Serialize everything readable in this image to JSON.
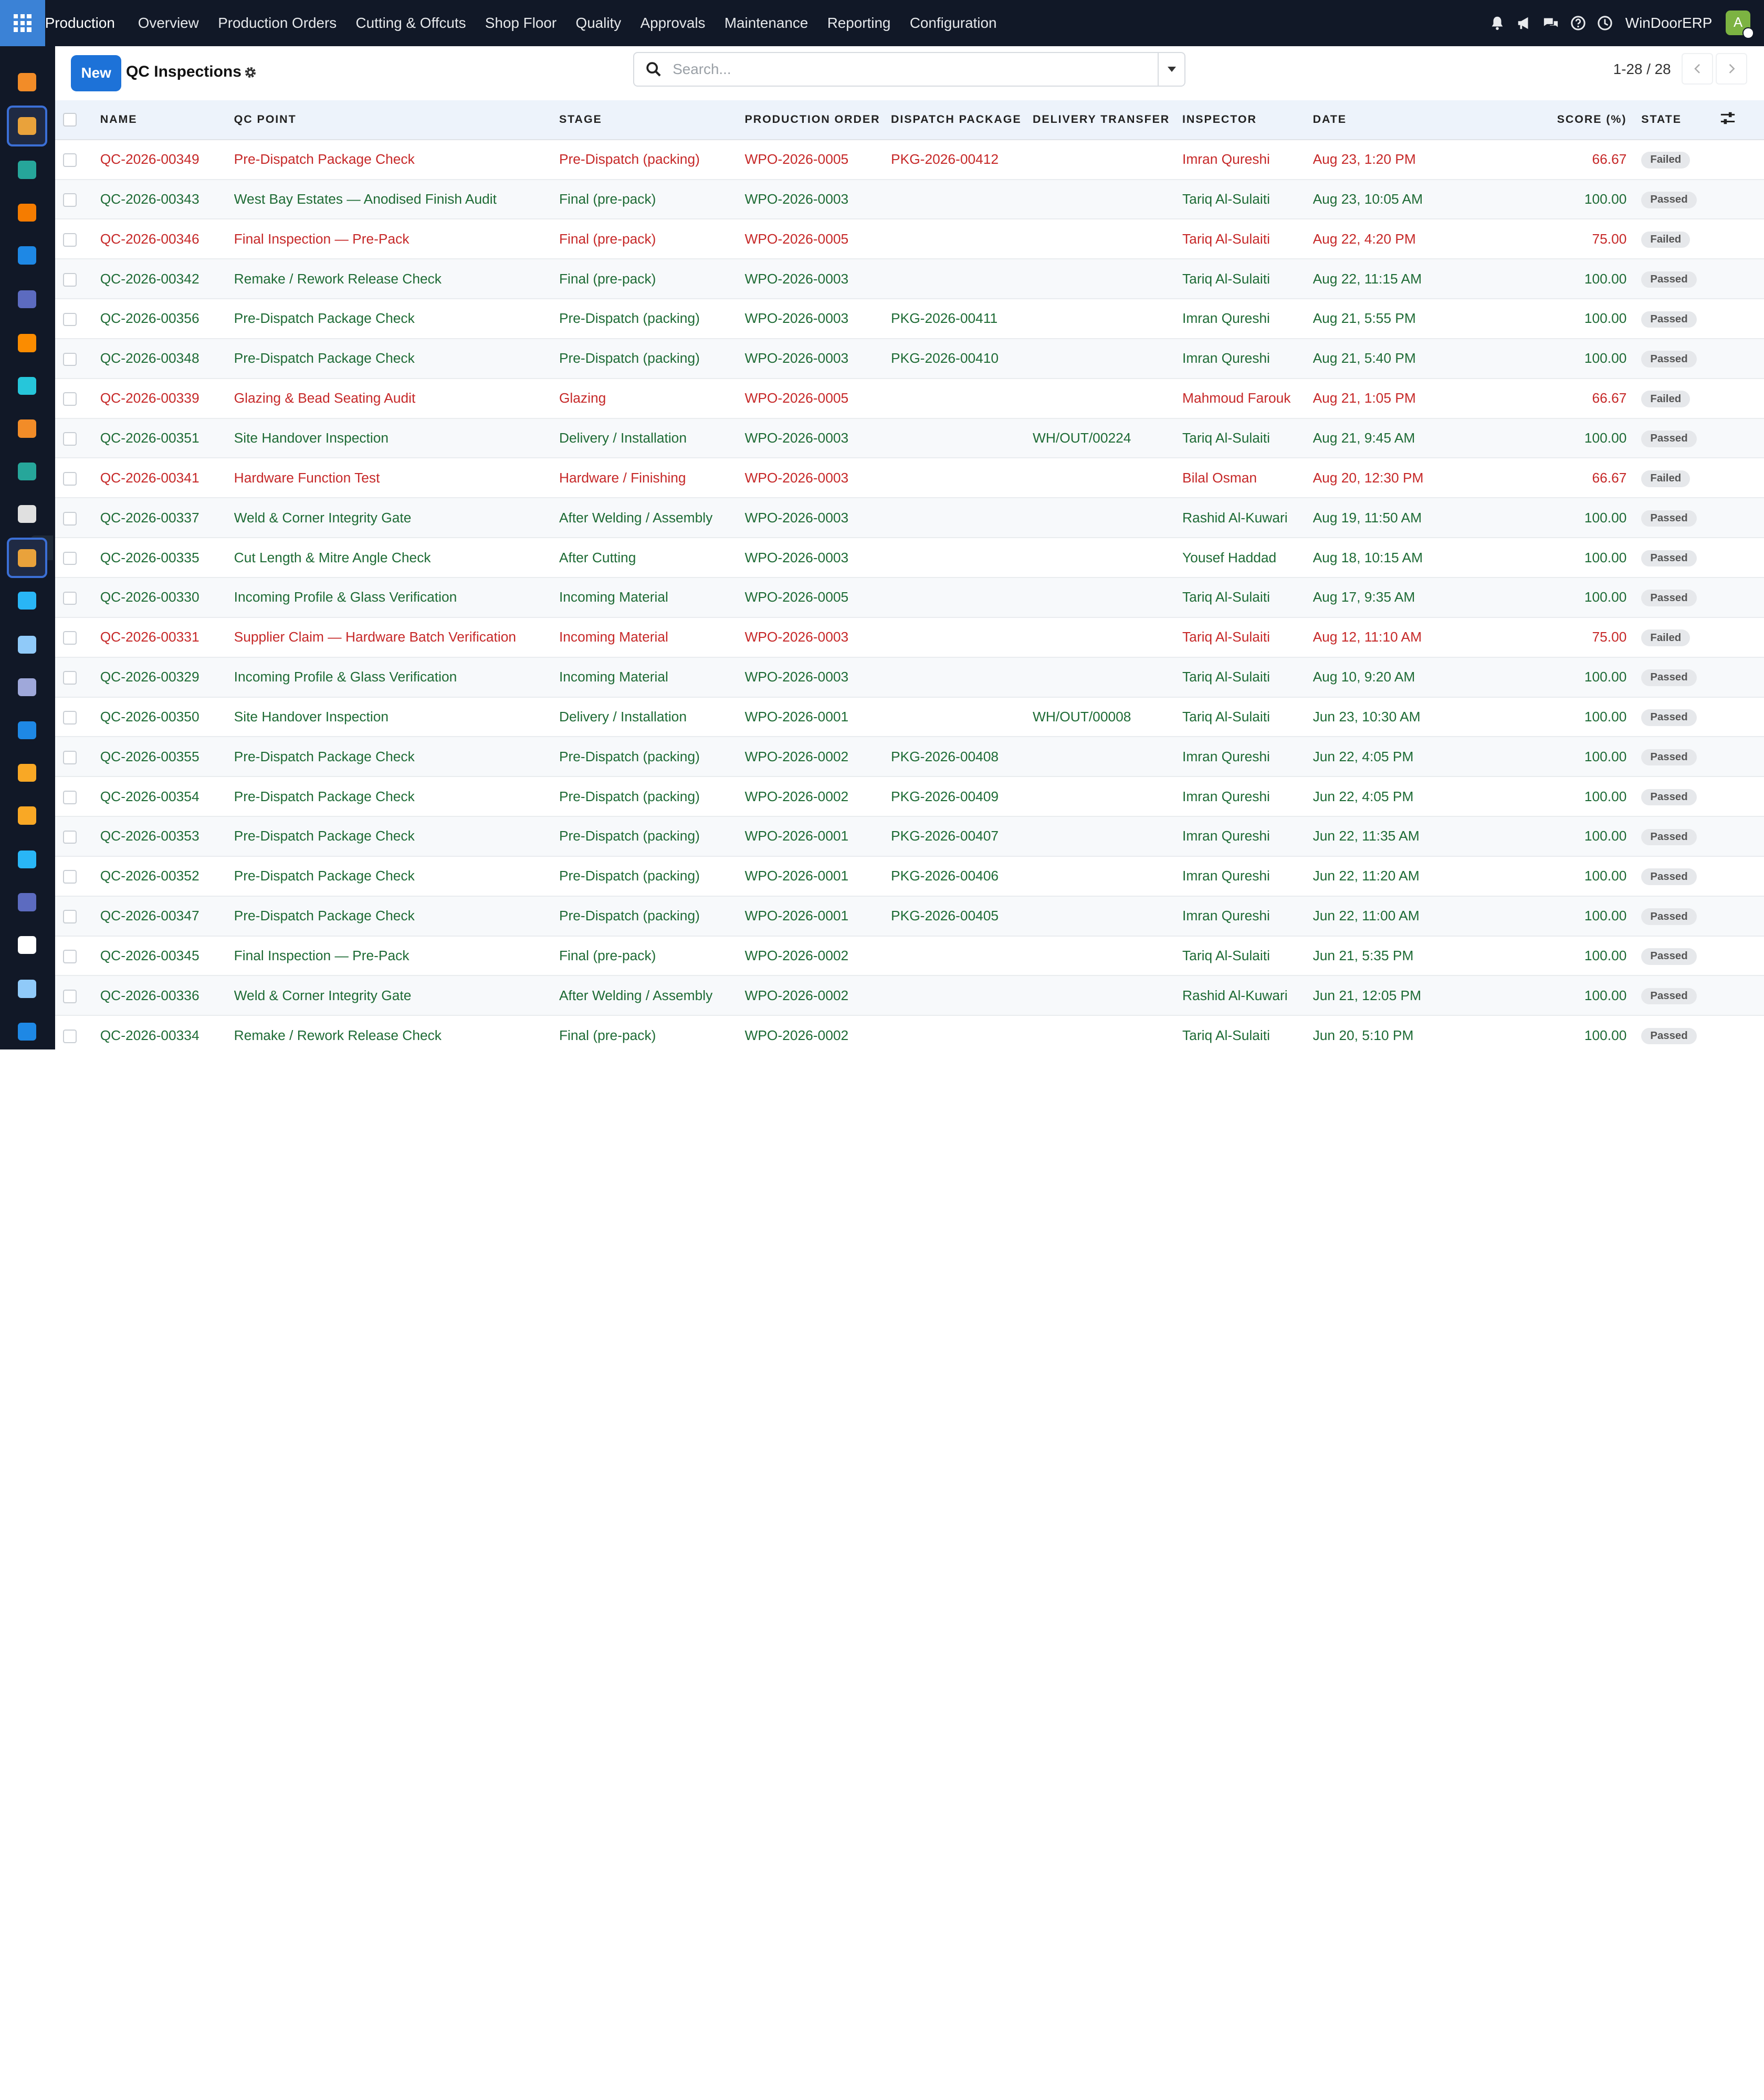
{
  "navbar": {
    "brand": "Production",
    "menu": [
      "Overview",
      "Production Orders",
      "Cutting & Offcuts",
      "Shop Floor",
      "Quality",
      "Approvals",
      "Maintenance",
      "Reporting",
      "Configuration"
    ],
    "company": "WinDoorERP",
    "avatar_letter": "A",
    "icons": [
      "bell-icon",
      "megaphone-icon",
      "chat-icon",
      "help-icon",
      "clock-icon"
    ]
  },
  "sidebar": {
    "icons": [
      {
        "name": "sales-app-icon",
        "color": "#f28c28"
      },
      {
        "name": "quality-app-icon",
        "color": "#e9a23b",
        "active": true
      },
      {
        "name": "contacts-app-icon",
        "color": "#26a69a"
      },
      {
        "name": "discuss-app-icon",
        "color": "#f57c00"
      },
      {
        "name": "website-app-icon",
        "color": "#1e88e5"
      },
      {
        "name": "mail-app-icon",
        "color": "#5c6bc0"
      },
      {
        "name": "chat-app-icon",
        "color": "#fb8c00"
      },
      {
        "name": "project-app-icon",
        "color": "#26c6da"
      },
      {
        "name": "reports-app-icon",
        "color": "#f28c28"
      },
      {
        "name": "employees-app-icon",
        "color": "#26a69a"
      },
      {
        "name": "inventory-app-icon",
        "color": "#e0e0e0"
      },
      {
        "name": "manufacturing-app-icon",
        "color": "#e9a23b",
        "active": true
      },
      {
        "name": "tasks-app-icon",
        "color": "#29b6f6"
      },
      {
        "name": "helpdesk-app-icon",
        "color": "#90caf9"
      },
      {
        "name": "packages-app-icon",
        "color": "#9fa8da"
      },
      {
        "name": "invoicing-app-icon",
        "color": "#1e88e5"
      },
      {
        "name": "team-app-icon",
        "color": "#f9a825"
      },
      {
        "name": "calendar-app-icon",
        "color": "#f9a825"
      },
      {
        "name": "sign-app-icon",
        "color": "#29b6f6"
      },
      {
        "name": "dashboard-app-icon",
        "color": "#5c6bc0"
      },
      {
        "name": "whatsapp-app-icon",
        "color": "#ffffff"
      },
      {
        "name": "planning-app-icon",
        "color": "#90caf9"
      },
      {
        "name": "website2-app-icon",
        "color": "#1e88e5"
      }
    ]
  },
  "control": {
    "new_label": "New",
    "title": "QC Inspections",
    "search_placeholder": "Search...",
    "pager": "1-28 / 28"
  },
  "table": {
    "columns": [
      "NAME",
      "QC POINT",
      "STAGE",
      "PRODUCTION ORDER",
      "DISPATCH PACKAGE",
      "DELIVERY TRANSFER",
      "INSPECTOR",
      "DATE",
      "SCORE (%)",
      "STATE"
    ],
    "rows": [
      {
        "name": "QC-2026-00349",
        "qc_point": "Pre-Dispatch Package Check",
        "stage": "Pre-Dispatch (packing)",
        "order": "WPO-2026-0005",
        "package": "PKG-2026-00412",
        "transfer": "",
        "inspector": "Imran Qureshi",
        "date": "Aug 23, 1:20 PM",
        "score": "66.67",
        "state": "Failed"
      },
      {
        "name": "QC-2026-00343",
        "qc_point": "West Bay Estates — Anodised Finish Audit",
        "stage": "Final (pre-pack)",
        "order": "WPO-2026-0003",
        "package": "",
        "transfer": "",
        "inspector": "Tariq Al-Sulaiti",
        "date": "Aug 23, 10:05 AM",
        "score": "100.00",
        "state": "Passed"
      },
      {
        "name": "QC-2026-00346",
        "qc_point": "Final Inspection — Pre-Pack",
        "stage": "Final (pre-pack)",
        "order": "WPO-2026-0005",
        "package": "",
        "transfer": "",
        "inspector": "Tariq Al-Sulaiti",
        "date": "Aug 22, 4:20 PM",
        "score": "75.00",
        "state": "Failed"
      },
      {
        "name": "QC-2026-00342",
        "qc_point": "Remake / Rework Release Check",
        "stage": "Final (pre-pack)",
        "order": "WPO-2026-0003",
        "package": "",
        "transfer": "",
        "inspector": "Tariq Al-Sulaiti",
        "date": "Aug 22, 11:15 AM",
        "score": "100.00",
        "state": "Passed"
      },
      {
        "name": "QC-2026-00356",
        "qc_point": "Pre-Dispatch Package Check",
        "stage": "Pre-Dispatch (packing)",
        "order": "WPO-2026-0003",
        "package": "PKG-2026-00411",
        "transfer": "",
        "inspector": "Imran Qureshi",
        "date": "Aug 21, 5:55 PM",
        "score": "100.00",
        "state": "Passed"
      },
      {
        "name": "QC-2026-00348",
        "qc_point": "Pre-Dispatch Package Check",
        "stage": "Pre-Dispatch (packing)",
        "order": "WPO-2026-0003",
        "package": "PKG-2026-00410",
        "transfer": "",
        "inspector": "Imran Qureshi",
        "date": "Aug 21, 5:40 PM",
        "score": "100.00",
        "state": "Passed"
      },
      {
        "name": "QC-2026-00339",
        "qc_point": "Glazing & Bead Seating Audit",
        "stage": "Glazing",
        "order": "WPO-2026-0005",
        "package": "",
        "transfer": "",
        "inspector": "Mahmoud Farouk",
        "date": "Aug 21, 1:05 PM",
        "score": "66.67",
        "state": "Failed"
      },
      {
        "name": "QC-2026-00351",
        "qc_point": "Site Handover Inspection",
        "stage": "Delivery / Installation",
        "order": "WPO-2026-0003",
        "package": "",
        "transfer": "WH/OUT/00224",
        "inspector": "Tariq Al-Sulaiti",
        "date": "Aug 21, 9:45 AM",
        "score": "100.00",
        "state": "Passed"
      },
      {
        "name": "QC-2026-00341",
        "qc_point": "Hardware Function Test",
        "stage": "Hardware / Finishing",
        "order": "WPO-2026-0003",
        "package": "",
        "transfer": "",
        "inspector": "Bilal Osman",
        "date": "Aug 20, 12:30 PM",
        "score": "66.67",
        "state": "Failed"
      },
      {
        "name": "QC-2026-00337",
        "qc_point": "Weld & Corner Integrity Gate",
        "stage": "After Welding / Assembly",
        "order": "WPO-2026-0003",
        "package": "",
        "transfer": "",
        "inspector": "Rashid Al-Kuwari",
        "date": "Aug 19, 11:50 AM",
        "score": "100.00",
        "state": "Passed"
      },
      {
        "name": "QC-2026-00335",
        "qc_point": "Cut Length & Mitre Angle Check",
        "stage": "After Cutting",
        "order": "WPO-2026-0003",
        "package": "",
        "transfer": "",
        "inspector": "Yousef Haddad",
        "date": "Aug 18, 10:15 AM",
        "score": "100.00",
        "state": "Passed"
      },
      {
        "name": "QC-2026-00330",
        "qc_point": "Incoming Profile & Glass Verification",
        "stage": "Incoming Material",
        "order": "WPO-2026-0005",
        "package": "",
        "transfer": "",
        "inspector": "Tariq Al-Sulaiti",
        "date": "Aug 17, 9:35 AM",
        "score": "100.00",
        "state": "Passed"
      },
      {
        "name": "QC-2026-00331",
        "qc_point": "Supplier Claim — Hardware Batch Verification",
        "stage": "Incoming Material",
        "order": "WPO-2026-0003",
        "package": "",
        "transfer": "",
        "inspector": "Tariq Al-Sulaiti",
        "date": "Aug 12, 11:10 AM",
        "score": "75.00",
        "state": "Failed"
      },
      {
        "name": "QC-2026-00329",
        "qc_point": "Incoming Profile & Glass Verification",
        "stage": "Incoming Material",
        "order": "WPO-2026-0003",
        "package": "",
        "transfer": "",
        "inspector": "Tariq Al-Sulaiti",
        "date": "Aug 10, 9:20 AM",
        "score": "100.00",
        "state": "Passed"
      },
      {
        "name": "QC-2026-00350",
        "qc_point": "Site Handover Inspection",
        "stage": "Delivery / Installation",
        "order": "WPO-2026-0001",
        "package": "",
        "transfer": "WH/OUT/00008",
        "inspector": "Tariq Al-Sulaiti",
        "date": "Jun 23, 10:30 AM",
        "score": "100.00",
        "state": "Passed"
      },
      {
        "name": "QC-2026-00355",
        "qc_point": "Pre-Dispatch Package Check",
        "stage": "Pre-Dispatch (packing)",
        "order": "WPO-2026-0002",
        "package": "PKG-2026-00408",
        "transfer": "",
        "inspector": "Imran Qureshi",
        "date": "Jun 22, 4:05 PM",
        "score": "100.00",
        "state": "Passed"
      },
      {
        "name": "QC-2026-00354",
        "qc_point": "Pre-Dispatch Package Check",
        "stage": "Pre-Dispatch (packing)",
        "order": "WPO-2026-0002",
        "package": "PKG-2026-00409",
        "transfer": "",
        "inspector": "Imran Qureshi",
        "date": "Jun 22, 4:05 PM",
        "score": "100.00",
        "state": "Passed"
      },
      {
        "name": "QC-2026-00353",
        "qc_point": "Pre-Dispatch Package Check",
        "stage": "Pre-Dispatch (packing)",
        "order": "WPO-2026-0001",
        "package": "PKG-2026-00407",
        "transfer": "",
        "inspector": "Imran Qureshi",
        "date": "Jun 22, 11:35 AM",
        "score": "100.00",
        "state": "Passed"
      },
      {
        "name": "QC-2026-00352",
        "qc_point": "Pre-Dispatch Package Check",
        "stage": "Pre-Dispatch (packing)",
        "order": "WPO-2026-0001",
        "package": "PKG-2026-00406",
        "transfer": "",
        "inspector": "Imran Qureshi",
        "date": "Jun 22, 11:20 AM",
        "score": "100.00",
        "state": "Passed"
      },
      {
        "name": "QC-2026-00347",
        "qc_point": "Pre-Dispatch Package Check",
        "stage": "Pre-Dispatch (packing)",
        "order": "WPO-2026-0001",
        "package": "PKG-2026-00405",
        "transfer": "",
        "inspector": "Imran Qureshi",
        "date": "Jun 22, 11:00 AM",
        "score": "100.00",
        "state": "Passed"
      },
      {
        "name": "QC-2026-00345",
        "qc_point": "Final Inspection — Pre-Pack",
        "stage": "Final (pre-pack)",
        "order": "WPO-2026-0002",
        "package": "",
        "transfer": "",
        "inspector": "Tariq Al-Sulaiti",
        "date": "Jun 21, 5:35 PM",
        "score": "100.00",
        "state": "Passed"
      },
      {
        "name": "QC-2026-00336",
        "qc_point": "Weld & Corner Integrity Gate",
        "stage": "After Welding / Assembly",
        "order": "WPO-2026-0002",
        "package": "",
        "transfer": "",
        "inspector": "Rashid Al-Kuwari",
        "date": "Jun 21, 12:05 PM",
        "score": "100.00",
        "state": "Passed"
      },
      {
        "name": "QC-2026-00334",
        "qc_point": "Remake / Rework Release Check",
        "stage": "Final (pre-pack)",
        "order": "WPO-2026-0002",
        "package": "",
        "transfer": "",
        "inspector": "Tariq Al-Sulaiti",
        "date": "Jun 20, 5:10 PM",
        "score": "100.00",
        "state": "Passed"
      }
    ]
  }
}
